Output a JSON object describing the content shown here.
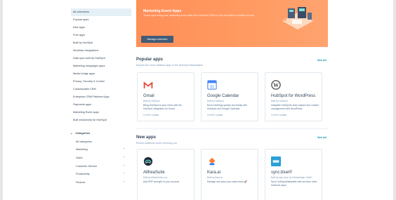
{
  "sidebar": {
    "items": [
      {
        "label": "All collections",
        "active": true
      },
      {
        "label": "Popular apps"
      },
      {
        "label": "New apps"
      },
      {
        "label": "Free apps"
      },
      {
        "label": "Built by HubSpot"
      },
      {
        "label": "Workflow integrations"
      },
      {
        "label": "Data sync built by HubSpot"
      },
      {
        "label": "Marketing campaigns apps"
      },
      {
        "label": "Media bridge apps"
      },
      {
        "label": "Privacy, Security & Control"
      },
      {
        "label": "Customizable CRM"
      },
      {
        "label": "Enterprise CRM Platform Apps"
      },
      {
        "label": "Payments apps"
      },
      {
        "label": "Marketing Event apps"
      },
      {
        "label": "Built exclusively for HubSpot"
      }
    ],
    "categories_header": "Categories",
    "categories": [
      {
        "label": "All categories",
        "has_chevron": false
      },
      {
        "label": "Marketing",
        "has_chevron": true
      },
      {
        "label": "Sales",
        "has_chevron": true
      },
      {
        "label": "Customer Service",
        "has_chevron": true
      },
      {
        "label": "Productivity",
        "has_chevron": true
      },
      {
        "label": "Finance",
        "has_chevron": true
      }
    ]
  },
  "banner": {
    "title": "Marketing Event Apps",
    "description": "Those apps bring your marketing event data into HubSpot CRM so you can deliver excellent events.",
    "button_label": "Manage collection",
    "color": "#ff8f59"
  },
  "popular": {
    "title": "Popular apps",
    "subtitle": "Explore the most installed apps in the HubSpot Marketplace",
    "see_all": "See all",
    "cards": [
      {
        "title": "Gmail",
        "by": "Built by HubSpot",
        "desc": "Bring HubSpot to your inbox with the HubSpot integration for Gmail.",
        "installs": "10,000+ installs",
        "icon": "gmail-icon"
      },
      {
        "title": "Google Calendar",
        "by": "Built by HubSpot",
        "desc": "Book meetings quickly and easily with HubSpot and Google Calendar.",
        "installs": "10,000+ installs",
        "icon": "google-calendar-icon"
      },
      {
        "title": "HubSpot for WordPress",
        "by": "Built by HubSpot",
        "desc": "Integrate HubSpot's lead capture and contact management with WordPress",
        "installs": "10,000+ installs",
        "icon": "wordpress-icon"
      }
    ]
  },
  "new_apps": {
    "title": "New apps",
    "subtitle": "Recent additions worth checking out",
    "see_all": "See all",
    "cards": [
      {
        "title": "AltheaSuite",
        "by": "Built by AltheaSuite.com",
        "desc": "Add ERP strength to your account.",
        "icon": "altheasuite-icon"
      },
      {
        "title": "Kara.ai",
        "by": "Built by Kara.ai",
        "desc": "Manage and save your sales team 🚀",
        "icon": "kara-icon"
      },
      {
        "title": "sync.blue®",
        "by": "Built by sync.blue by Schwieringer GmbH",
        "desc": "Sync HubSpot/datatable with services other business apps",
        "icon": "syncblue-icon"
      }
    ]
  }
}
